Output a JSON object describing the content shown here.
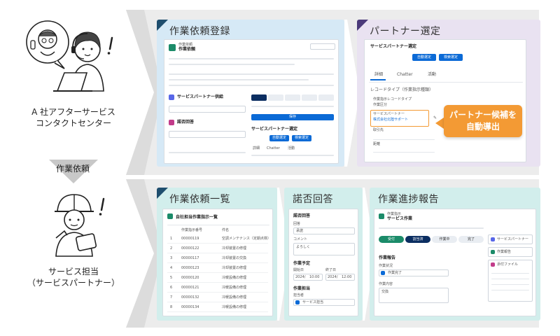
{
  "actors": {
    "top": {
      "label_line1": "A 社アフターサービス",
      "label_line2": "コンタクトセンター"
    },
    "bottom": {
      "label_line1": "サービス担当",
      "label_line2": "（サービスパートナー）"
    },
    "between_label": "作業依頼"
  },
  "top_band": {
    "panel1": {
      "title": "作業依頼登録",
      "record_type": "作業依頼",
      "record_name": "作業依頼",
      "section_dispatch": "サービスパートナー供給",
      "section_reply": "諾否回答",
      "button_save": "保存",
      "tab_details": "詳細",
      "tab_chatter": "Chatter",
      "tab_activity": "活動"
    },
    "panel2": {
      "title": "パートナー選定",
      "card_title": "サービスパートナー選定",
      "btn_auto": "自動選定",
      "btn_search": "検索選定",
      "tab_details": "詳細",
      "tab_chatter": "Chatter",
      "tab_activity": "活動",
      "section_record_type": "レコードタイプ（作業指示種類）",
      "field_record_type": "作業指示レコードタイプ",
      "field_work_category": "作業区分",
      "field_partner": "サービスパートナー",
      "field_partner_value": "株式会社北陸サポート",
      "field_distance": "距離",
      "field_other": "取引先",
      "callout_line1": "パートナー候補を",
      "callout_line2": "自動導出"
    }
  },
  "bottom_band": {
    "panel1": {
      "title": "作業依頼一覧",
      "list_name": "自社担当作業指示一覧",
      "col_number": "作業指示番号",
      "col_subject": "件名",
      "rows": [
        {
          "idx": "1",
          "number": "00000119",
          "subject": "空調メンテナンス（定期点検）"
        },
        {
          "idx": "2",
          "number": "00000122",
          "subject": "冷却装置の修理"
        },
        {
          "idx": "3",
          "number": "00000117",
          "subject": "冷却装置の交換"
        },
        {
          "idx": "4",
          "number": "00000123",
          "subject": "冷却装置の修理"
        },
        {
          "idx": "5",
          "number": "00000120",
          "subject": "冷暖設備の修理"
        },
        {
          "idx": "6",
          "number": "00000121",
          "subject": "冷暖設備の修理"
        },
        {
          "idx": "7",
          "number": "00000132",
          "subject": "冷暖設備の修理"
        },
        {
          "idx": "8",
          "number": "00000134",
          "subject": "冷暖設備の修理"
        }
      ]
    },
    "panel2": {
      "title": "諾否回答",
      "section_reply": "諾否回答",
      "field_reply": "回答",
      "field_reply_value": "承諾",
      "field_comment": "コメント",
      "field_comment_value": "よろしく",
      "section_schedule": "作業予定",
      "field_start": "開始日",
      "field_end": "終了日",
      "start_date": "2024/",
      "start_time": "10:00",
      "end_date": "2024/",
      "end_time": "12:00",
      "section_assignee": "作業担当",
      "field_assignee": "担当者",
      "field_assignee_value": "サービス担当"
    },
    "panel3": {
      "title": "作業進捗報告",
      "record_type": "作業指示",
      "record_name": "サービス作業",
      "steps": [
        "受付",
        "割当済",
        "作業中",
        "完了"
      ],
      "section_report": "作業報告",
      "field_status": "作業状況",
      "field_status_value": "作業完了",
      "field_notes": "作業内容",
      "field_notes_value": "交換",
      "side1": "サービスパートナー",
      "side2": "作業報告",
      "side3": "添付ファイル"
    }
  },
  "colors": {
    "top_band_bg": "#ededed",
    "bottom_band_bg": "#ededed",
    "top_p1_bg": "#d6e9f6",
    "top_p2_bg": "#e9e2f1",
    "bottom_panel_bg": "#d2eeec",
    "callout": "#f39a34",
    "accent_blue": "#0b6ad6",
    "accent_navy": "#0b2e61"
  }
}
